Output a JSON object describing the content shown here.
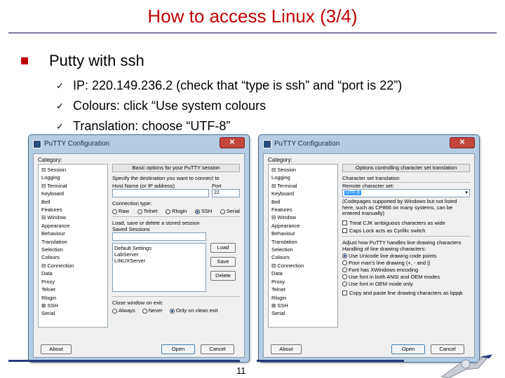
{
  "slide": {
    "title": "How to access Linux (3/4)",
    "bullet": "Putty with ssh",
    "subbullets": [
      "IP: 220.149.236.2 (check that “type is ssh” and “port is 22”)",
      "Colours: click “Use system colours",
      "Translation: choose “UTF-8”"
    ],
    "page_number": "11"
  },
  "left_window": {
    "title": "PuTTY Configuration",
    "category_label": "Category:",
    "tree": [
      "⊟ Session",
      "    Logging",
      "⊟ Terminal",
      "    Keyboard",
      "    Bell",
      "    Features",
      "⊟ Window",
      "    Appearance",
      "    Behaviour",
      "    Translation",
      "    Selection",
      "    Colours",
      "⊟ Connection",
      "    Data",
      "    Proxy",
      "    Telnet",
      "    Rlogin",
      "  ⊞ SSH",
      "    Serial"
    ],
    "panel_title": "Basic options for your PuTTY session",
    "destination_label": "Specify the destination you want to connect to",
    "host_label": "Host Name (or IP address)",
    "port_label": "Port",
    "port_value": "22",
    "conn_type_label": "Connection type:",
    "conn_types": [
      "Raw",
      "Telnet",
      "Rlogin",
      "SSH",
      "Serial"
    ],
    "sessions_group": "Load, save or delete a stored session",
    "saved_sessions_label": "Saved Sessions",
    "session_list": [
      "Default Settings",
      "LabServer",
      "LINUXServer"
    ],
    "load": "Load",
    "save": "Save",
    "delete": "Delete",
    "close_label": "Close window on exit:",
    "close_opts": [
      "Always",
      "Never",
      "Only on clean exit"
    ],
    "about": "About",
    "open": "Open",
    "cancel": "Cancel"
  },
  "right_window": {
    "title": "PuTTY Configuration",
    "category_label": "Category:",
    "tree": [
      "⊟ Session",
      "    Logging",
      "⊟ Terminal",
      "    Keyboard",
      "    Bell",
      "    Features",
      "⊟ Window",
      "    Appearance",
      "    Behaviour",
      "    Translation",
      "    Selection",
      "    Colours",
      "⊟ Connection",
      "    Data",
      "    Proxy",
      "    Telnet",
      "    Rlogin",
      "  ⊞ SSH",
      "    Serial"
    ],
    "panel_title": "Options controlling character set translation",
    "charset_group": "Character set translation",
    "remote_label": "Remote character set:",
    "remote_value": "UTF-8",
    "codepages_note": "(Codepages supported by Windows but not listed here, such as CP866 on many systems, can be entered manually)",
    "cjk_option": "Treat CJK ambiguous characters as wide",
    "caps_option": "Caps Lock acts as Cyrillic switch",
    "adjust_group": "Adjust how PuTTY handles line drawing characters",
    "handling_label": "Handling of line drawing characters:",
    "handling_opts": [
      "Use Unicode line drawing code points",
      "Poor man's line drawing (+, - and |)",
      "Font has XWindows encoding",
      "Use font in both ANSI and OEM modes",
      "Use font in OEM mode only"
    ],
    "copy_option": "Copy and paste line drawing characters as lqqqk",
    "about": "About",
    "open": "Open",
    "cancel": "Cancel"
  }
}
